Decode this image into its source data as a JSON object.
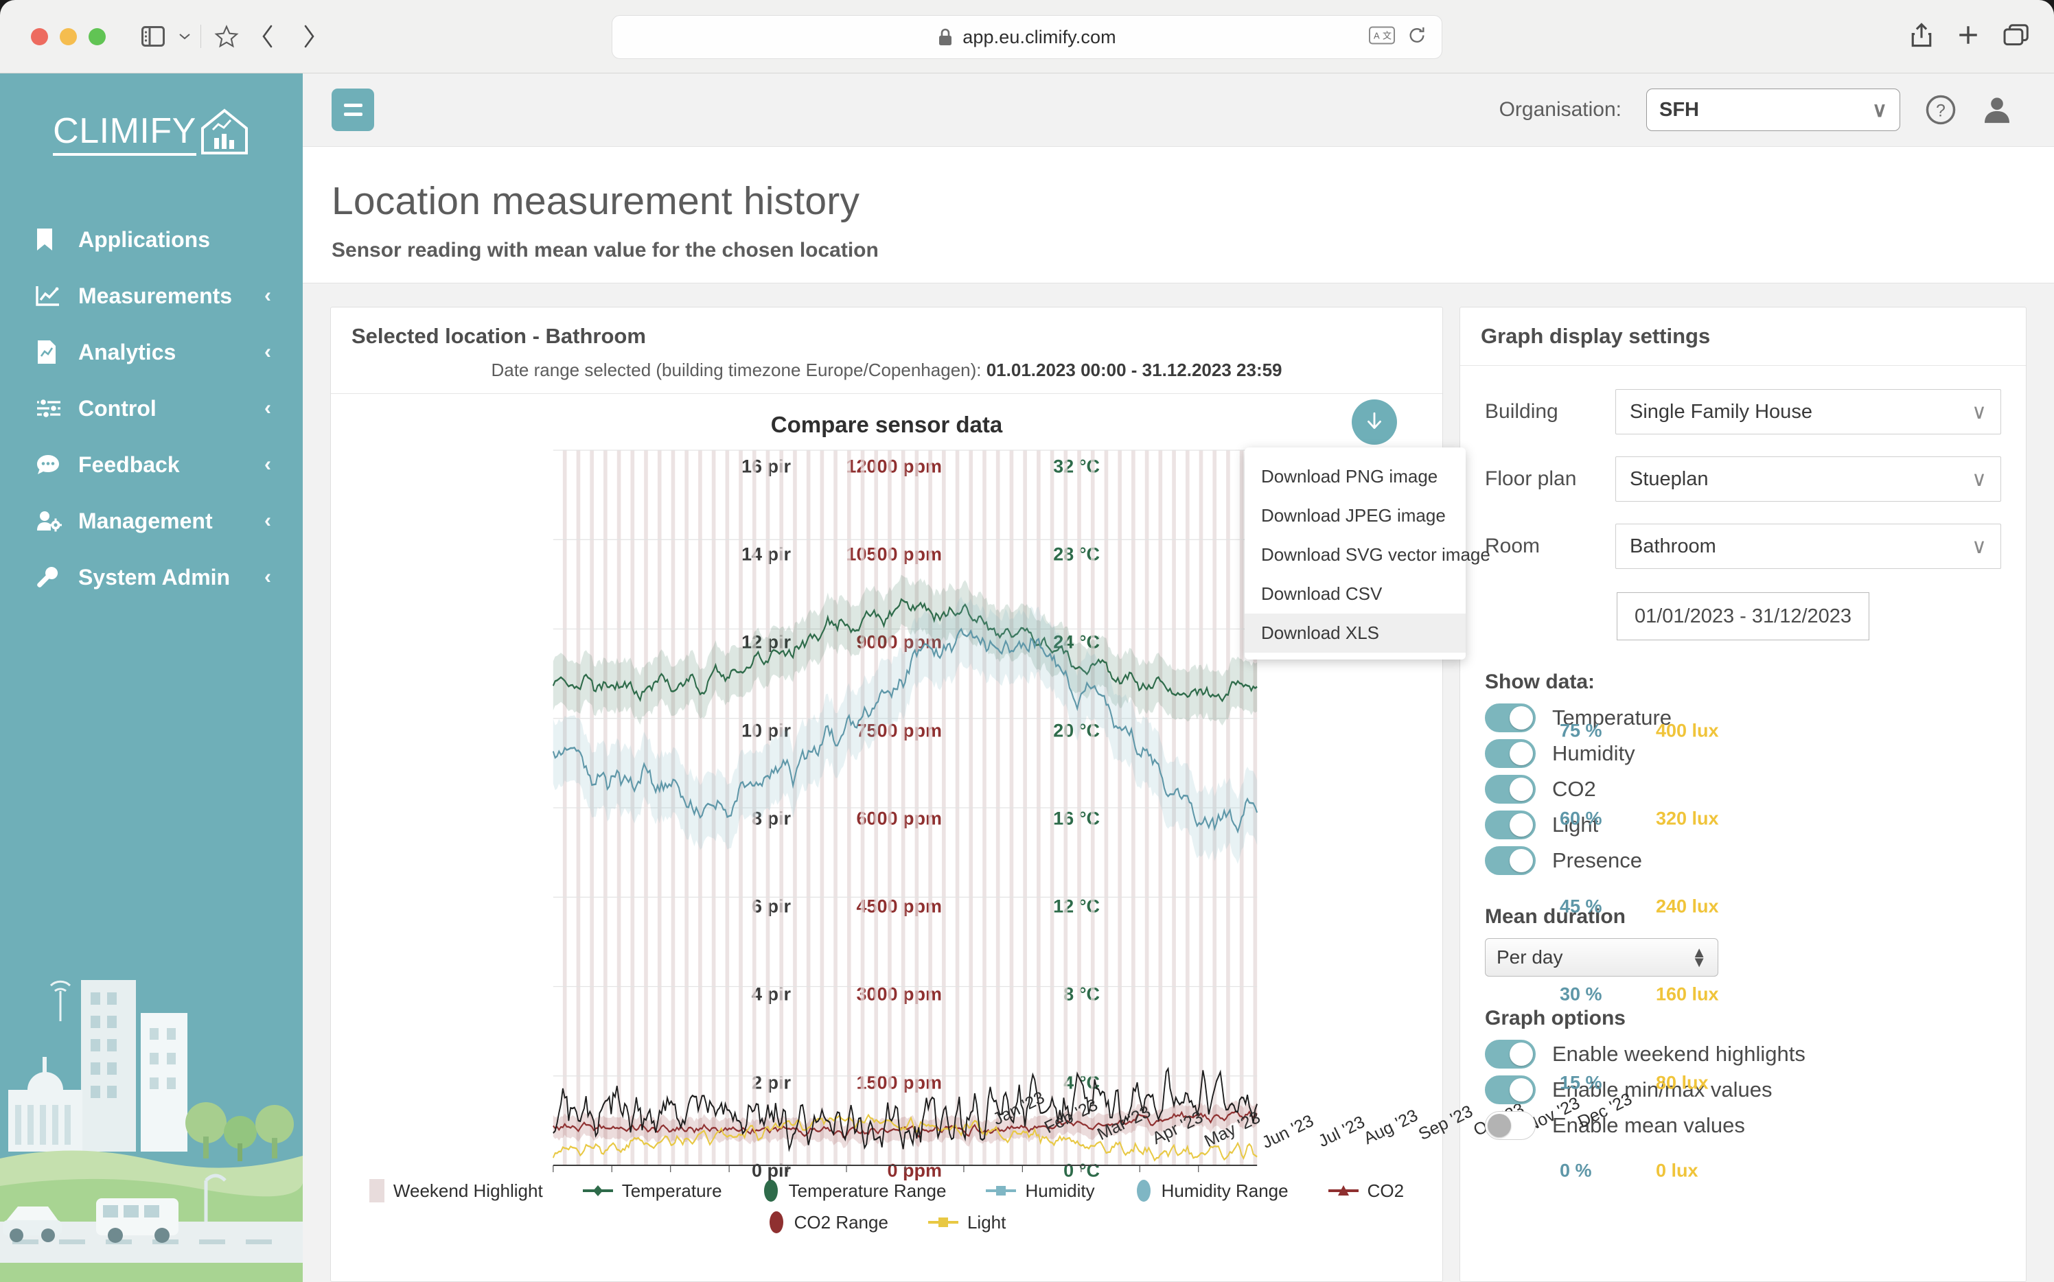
{
  "browser": {
    "url": "app.eu.climify.com",
    "icons": [
      "sidebar-toggle-icon",
      "chevron-down-icon",
      "bookmark-star-icon",
      "back-icon",
      "forward-icon",
      "lock-icon",
      "translate-icon",
      "reload-icon",
      "share-icon",
      "new-tab-icon",
      "tabs-overview-icon"
    ]
  },
  "sidebar": {
    "logo_text": "CLIMIFY",
    "items": [
      {
        "label": "Applications",
        "icon": "bookmark-icon",
        "chevron": false
      },
      {
        "label": "Measurements",
        "icon": "line-chart-icon",
        "chevron": true
      },
      {
        "label": "Analytics",
        "icon": "report-icon",
        "chevron": true
      },
      {
        "label": "Control",
        "icon": "sliders-icon",
        "chevron": true
      },
      {
        "label": "Feedback",
        "icon": "chat-icon",
        "chevron": true
      },
      {
        "label": "Management",
        "icon": "user-gear-icon",
        "chevron": true
      },
      {
        "label": "System Admin",
        "icon": "wrench-icon",
        "chevron": true
      }
    ],
    "chevron_glyph": "‹"
  },
  "topbar": {
    "menu_button": "hamburger-menu",
    "org_label": "Organisation:",
    "org_value": "SFH",
    "help": "?",
    "chevron_glyph": "∨"
  },
  "page": {
    "title": "Location measurement history",
    "subtitle": "Sensor reading with mean value for the chosen location"
  },
  "chart_card": {
    "header": "Selected location - Bathroom",
    "daterange_prefix": "Date range selected (building timezone Europe/Copenhagen): ",
    "daterange_value": "01.01.2023 00:00 - 31.12.2023 23:59"
  },
  "download": {
    "button": "download-icon",
    "items": [
      {
        "label": "Download PNG image",
        "selected": false
      },
      {
        "label": "Download JPEG image",
        "selected": false
      },
      {
        "label": "Download SVG vector image",
        "selected": false
      },
      {
        "label": "Download CSV",
        "selected": false
      },
      {
        "label": "Download XLS",
        "selected": true
      }
    ]
  },
  "settings": {
    "title": "Graph display settings",
    "building_label": "Building",
    "building_value": "Single Family House",
    "floorplan_label": "Floor plan",
    "floorplan_value": "Stueplan",
    "room_label": "Room",
    "room_value": "Bathroom",
    "daterange_value": "01/01/2023 - 31/12/2023",
    "show_data_title": "Show data:",
    "show_data": [
      {
        "label": "Temperature",
        "on": true
      },
      {
        "label": "Humidity",
        "on": true
      },
      {
        "label": "CO2",
        "on": true
      },
      {
        "label": "Light",
        "on": true
      },
      {
        "label": "Presence",
        "on": true
      }
    ],
    "mean_duration_title": "Mean duration",
    "mean_duration_value": "Per day",
    "graph_options_title": "Graph options",
    "graph_options": [
      {
        "label": "Enable weekend highlights",
        "on": true
      },
      {
        "label": "Enable min/max values",
        "on": true
      },
      {
        "label": "Enable mean values",
        "on": false
      }
    ],
    "chevron_glyph": "∨"
  },
  "chart_data": {
    "type": "line",
    "title": "Compare sensor data",
    "xlabel": "",
    "x_ticks": [
      "Jan '23",
      "Feb '23",
      "Mar '23",
      "Apr '23",
      "May '23",
      "Jun '23",
      "Jul '23",
      "Aug '23",
      "Sep '23",
      "Oct '23",
      "Nov '23",
      "Dec '23"
    ],
    "grid": true,
    "legend_position": "bottom",
    "axes": [
      {
        "name": "Presence",
        "unit": "pir",
        "color": "#3b3b3b",
        "ticks": [
          "16 pir",
          "14 pir",
          "12 pir",
          "10 pir",
          "8 pir",
          "6 pir",
          "4 pir",
          "2 pir",
          "0 pir"
        ],
        "range": [
          0,
          16
        ],
        "side": "left"
      },
      {
        "name": "CO2",
        "unit": "ppm",
        "color": "#8f3030",
        "ticks": [
          "12000 ppm",
          "10500 ppm",
          "9000 ppm",
          "7500 ppm",
          "6000 ppm",
          "4500 ppm",
          "3000 ppm",
          "1500 ppm",
          "0 ppm"
        ],
        "range": [
          0,
          12000
        ],
        "side": "left"
      },
      {
        "name": "Temperature",
        "unit": "°C",
        "color": "#2e6b4a",
        "ticks": [
          "32 °C",
          "28 °C",
          "24 °C",
          "20 °C",
          "16 °C",
          "12 °C",
          "8 °C",
          "4 °C",
          "0 °C"
        ],
        "range": [
          0,
          32
        ],
        "side": "left"
      },
      {
        "name": "Humidity",
        "unit": "%",
        "color": "#5e97a8",
        "ticks": [
          "75 %",
          "60 %",
          "45 %",
          "30 %",
          "15 %",
          "0 %"
        ],
        "range": [
          0,
          75
        ],
        "side": "right"
      },
      {
        "name": "Light",
        "unit": "lux",
        "color": "#f0c43a",
        "ticks": [
          "400 lux",
          "320 lux",
          "240 lux",
          "160 lux",
          "80 lux",
          "0 lux"
        ],
        "range": [
          0,
          400
        ],
        "side": "right"
      }
    ],
    "legend": [
      {
        "label": "Weekend Highlight",
        "color": "#e8dcdc",
        "marker": "band"
      },
      {
        "label": "Temperature",
        "color": "#2e6b4a",
        "marker": "line-diamond"
      },
      {
        "label": "Temperature Range",
        "color": "#2e6b4a",
        "marker": "ellipse"
      },
      {
        "label": "Humidity",
        "color": "#7fb6c4",
        "marker": "line-square"
      },
      {
        "label": "Humidity Range",
        "color": "#7fb6c4",
        "marker": "ellipse"
      },
      {
        "label": "CO2",
        "color": "#8f3030",
        "marker": "line-triangle"
      },
      {
        "label": "CO2 Range",
        "color": "#8f3030",
        "marker": "ellipse"
      },
      {
        "label": "Light",
        "color": "#e8c843",
        "marker": "line-square"
      }
    ],
    "series": [
      {
        "name": "Temperature",
        "unit": "°C",
        "color": "#2e6b4a",
        "axis": "Temperature",
        "monthly_mean": [
          21.5,
          21.4,
          21.6,
          22.0,
          23.2,
          24.3,
          25.0,
          24.6,
          23.8,
          22.6,
          21.6,
          21.1
        ]
      },
      {
        "name": "Humidity",
        "unit": "%",
        "color": "#5e97a8",
        "axis": "Humidity",
        "monthly_mean": [
          43,
          41,
          39,
          38,
          42,
          46,
          52,
          56,
          55,
          50,
          44,
          36
        ]
      },
      {
        "name": "CO2",
        "unit": "ppm",
        "color": "#8f3030",
        "axis": "CO2",
        "monthly_mean": [
          620,
          640,
          610,
          600,
          580,
          560,
          570,
          590,
          640,
          680,
          760,
          820
        ]
      },
      {
        "name": "Light",
        "unit": "lux",
        "color": "#e8c843",
        "axis": "Light",
        "monthly_mean": [
          8,
          10,
          14,
          18,
          22,
          24,
          24,
          20,
          16,
          12,
          8,
          7
        ]
      },
      {
        "name": "Presence",
        "unit": "pir",
        "color": "#1c1c1c",
        "axis": "Presence",
        "monthly_mean": [
          1.2,
          1.3,
          1.1,
          1.2,
          1.0,
          0.9,
          1.0,
          1.1,
          1.3,
          1.4,
          1.6,
          1.5
        ]
      }
    ]
  }
}
